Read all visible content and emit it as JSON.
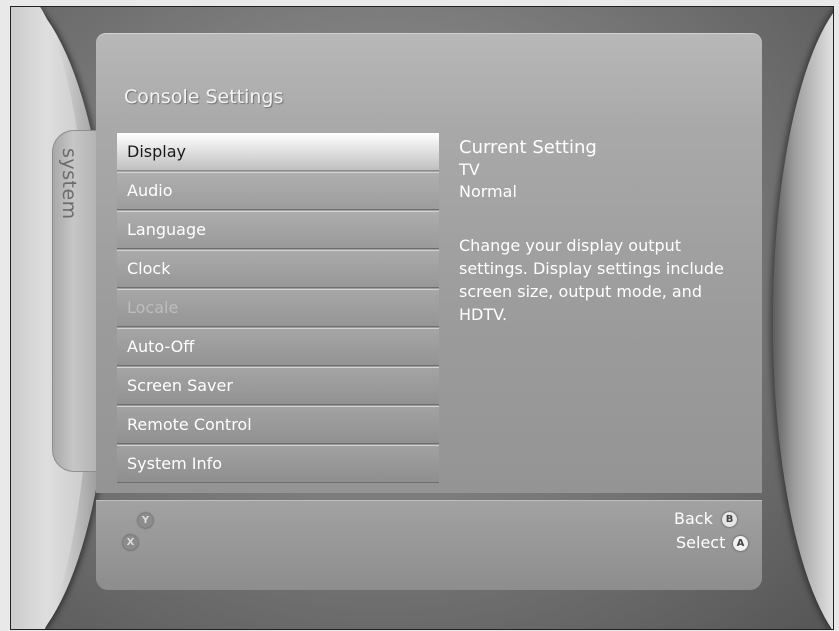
{
  "sidebar": {
    "tab_label": "system"
  },
  "header": {
    "title": "Console Settings"
  },
  "menu": {
    "items": [
      {
        "label": "Display",
        "state": "selected"
      },
      {
        "label": "Audio",
        "state": "normal"
      },
      {
        "label": "Language",
        "state": "normal"
      },
      {
        "label": "Clock",
        "state": "normal"
      },
      {
        "label": "Locale",
        "state": "disabled"
      },
      {
        "label": "Auto-Off",
        "state": "normal"
      },
      {
        "label": "Screen Saver",
        "state": "normal"
      },
      {
        "label": "Remote Control",
        "state": "normal"
      },
      {
        "label": "System Info",
        "state": "normal"
      }
    ]
  },
  "info": {
    "heading": "Current Setting",
    "values": [
      "TV",
      "Normal"
    ],
    "description": "Change your display output settings. Display settings include screen size, output mode, and HDTV."
  },
  "footer": {
    "y_glyph": "Y",
    "x_glyph": "X",
    "back_label": "Back",
    "back_glyph": "B",
    "select_label": "Select",
    "select_glyph": "A"
  }
}
